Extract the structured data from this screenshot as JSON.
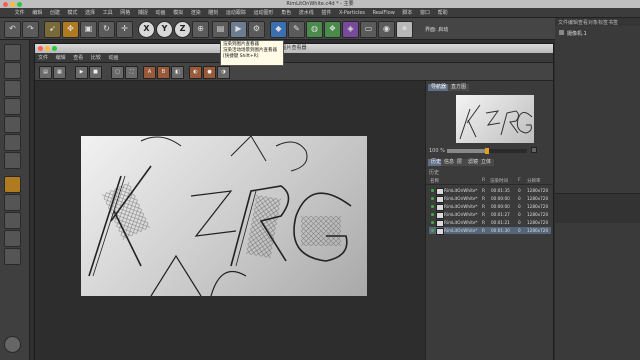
{
  "app": {
    "title": "RimLitOnWhite.c4d * - 主要",
    "menu": [
      "文件",
      "编辑",
      "创建",
      "模式",
      "选择",
      "工具",
      "网格",
      "捕捉",
      "动画",
      "模拟",
      "渲染",
      "雕刻",
      "运动跟踪",
      "运动图形",
      "角色",
      "流水线",
      "插件",
      "X-Particles",
      "RealFlow",
      "脚本",
      "窗口",
      "帮助"
    ],
    "toolbar_letters": [
      "X",
      "Y",
      "Z"
    ],
    "layout_label": "界面: 启动"
  },
  "tooltip": {
    "lines": [
      "渲染到图片查看器",
      "渲染活动场景到图片查看器",
      "[快捷键 Shift+R]"
    ]
  },
  "picture_viewer": {
    "title": "图片查看器",
    "menu": [
      "文件",
      "编辑",
      "查看",
      "比较",
      "动画"
    ],
    "zoom": "100 %",
    "zoom_fraction": 0.5,
    "side_tabs": [
      "导航器",
      "直方图"
    ],
    "history_tabs": [
      "历史",
      "信息",
      "层",
      "滤镜",
      "立体"
    ],
    "section_label": "历史",
    "columns": [
      "名称",
      "R",
      "渲染时间",
      "F",
      "分辨率"
    ],
    "rows": [
      {
        "name": "RimLitOnWhite*",
        "r": "R",
        "time": "00:01:35",
        "f": "0",
        "res": "1280x720",
        "selected": false
      },
      {
        "name": "RimLitOnWhite*",
        "r": "R",
        "time": "00:00:00",
        "f": "0",
        "res": "1280x720",
        "selected": false
      },
      {
        "name": "RimLitOnWhite*",
        "r": "R",
        "time": "00:00:00",
        "f": "0",
        "res": "1280x720",
        "selected": false
      },
      {
        "name": "RimLitOnWhite*",
        "r": "R",
        "time": "00:01:27",
        "f": "0",
        "res": "1280x720",
        "selected": false
      },
      {
        "name": "RimLitOnWhite*",
        "r": "R",
        "time": "00:01:21",
        "f": "0",
        "res": "1280x720",
        "selected": false
      },
      {
        "name": "RimLitOnWhite*",
        "r": "R",
        "time": "00:01:30",
        "f": "0",
        "res": "1280x720",
        "selected": true
      }
    ]
  },
  "right_dock": {
    "tabs": [
      "文件",
      "编辑",
      "查看",
      "对象",
      "标签",
      "书签"
    ],
    "item": "摄像机.1"
  },
  "colors": {
    "status_dot": "#3cb043",
    "zoom_handle": "#e0a020",
    "selected_row": "#55657a"
  }
}
